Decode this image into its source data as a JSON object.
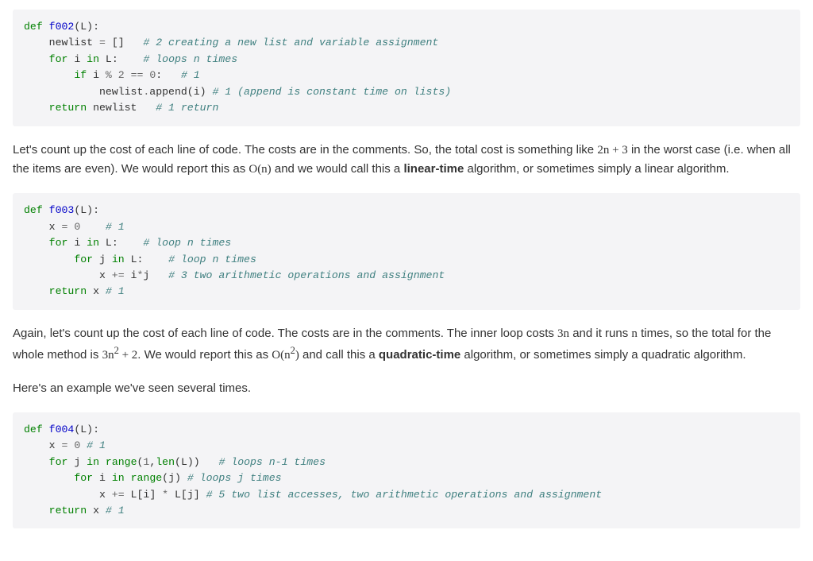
{
  "code1": {
    "l1": {
      "kw": "def",
      "name": "f002",
      "paren_open": "(",
      "arg": "L",
      "paren_close": "):"
    },
    "l2": {
      "id": "newlist",
      "eq": " = ",
      "br": "[]",
      "sp": "   ",
      "cmt": "# 2 creating a new list and variable assignment"
    },
    "l3": {
      "kw": "for",
      "sp1": " ",
      "i": "i",
      "sp2": " ",
      "in": "in",
      "sp3": " ",
      "L": "L",
      "colon": ":",
      "pad": "    ",
      "cmt": "# loops n times"
    },
    "l4": {
      "kw": "if",
      "sp1": " ",
      "i": "i",
      "sp2": " ",
      "mod": "%",
      "sp3": " ",
      "two": "2",
      "sp4": " ",
      "eq": "==",
      "sp5": " ",
      "zero": "0",
      "colon": ":",
      "pad": "   ",
      "cmt": "# 1"
    },
    "l5": {
      "obj": "newlist",
      "dot": ".",
      "meth": "append",
      "po": "(",
      "arg": "i",
      "pc": ")",
      "sp": " ",
      "cmt": "# 1 (append is constant time on lists)"
    },
    "l6": {
      "kw": "return",
      "sp": " ",
      "id": "newlist",
      "pad": "   ",
      "cmt": "# 1 return"
    }
  },
  "para1": {
    "a": "Let's count up the cost of each line of code. The costs are in the comments. So, the total cost is something like ",
    "m1": "2n + 3",
    "b": " in the worst case (i.e. when all the items are even). We would report this as ",
    "m2": "O(n)",
    "c": " and we would call this a ",
    "bold": "linear-time",
    "d": " algorithm, or sometimes simply a linear algorithm."
  },
  "code2": {
    "l1": {
      "kw": "def",
      "name": "f003",
      "po": "(",
      "arg": "L",
      "pc": "):"
    },
    "l2": {
      "x": "x",
      "eq": " = ",
      "zero": "0",
      "pad": "    ",
      "cmt": "# 1"
    },
    "l3": {
      "kw": "for",
      "sp1": " ",
      "i": "i",
      "sp2": " ",
      "in": "in",
      "sp3": " ",
      "L": "L",
      "colon": ":",
      "pad": "    ",
      "cmt": "# loop n times"
    },
    "l4": {
      "kw": "for",
      "sp1": " ",
      "j": "j",
      "sp2": " ",
      "in": "in",
      "sp3": " ",
      "L": "L",
      "colon": ":",
      "pad": "    ",
      "cmt": "# loop n times"
    },
    "l5": {
      "x": "x",
      "pe": " += ",
      "i": "i",
      "star": "*",
      "j": "j",
      "pad": "   ",
      "cmt": "# 3 two arithmetic operations and assignment"
    },
    "l6": {
      "kw": "return",
      "sp": " ",
      "x": "x",
      "sp2": " ",
      "cmt": "# 1"
    }
  },
  "para2": {
    "a": "Again, let's count up the cost of each line of code. The costs are in the comments. The inner loop costs ",
    "m1": "3n",
    "b": " and it runs ",
    "m2": "n",
    "c": " times, so the total for the whole method is ",
    "m3_a": "3n",
    "m3_sup": "2",
    "m3_b": " + 2",
    "d": ". We would report this as ",
    "m4_a": "O(n",
    "m4_sup": "2",
    "m4_b": ")",
    "e": " and call this a ",
    "bold": "quadratic-time",
    "f": " algorithm, or sometimes simply a quadratic algorithm."
  },
  "para3": "Here's an example we've seen several times.",
  "code3": {
    "l1": {
      "kw": "def",
      "name": "f004",
      "po": "(",
      "arg": "L",
      "pc": "):"
    },
    "l2": {
      "x": "x",
      "eq": " = ",
      "zero": "0",
      "sp": " ",
      "cmt": "# 1"
    },
    "l3": {
      "kw": "for",
      "s1": " ",
      "j": "j",
      "s2": " ",
      "in": "in",
      "s3": " ",
      "rng": "range",
      "po": "(",
      "one": "1",
      "com": ",",
      "len": "len",
      "po2": "(",
      "L": "L",
      "pc2": ")",
      "pc": ")",
      "pad": "   ",
      "cmt": "# loops n-1 times"
    },
    "l4": {
      "kw": "for",
      "s1": " ",
      "i": "i",
      "s2": " ",
      "in": "in",
      "s3": " ",
      "rng": "range",
      "po": "(",
      "j": "j",
      "pc": ")",
      "sp": " ",
      "cmt": "# loops j times"
    },
    "l5": {
      "x": "x",
      "pe": " += ",
      "L1": "L",
      "b1o": "[",
      "i": "i",
      "b1c": "]",
      "s1": " ",
      "star": "*",
      "s2": " ",
      "L2": "L",
      "b2o": "[",
      "j": "j",
      "b2c": "]",
      "sp": " ",
      "cmt": "# 5 two list accesses, two arithmetic operations and assignment"
    },
    "l6": {
      "kw": "return",
      "sp": " ",
      "x": "x",
      "sp2": " ",
      "cmt": "# 1"
    }
  }
}
